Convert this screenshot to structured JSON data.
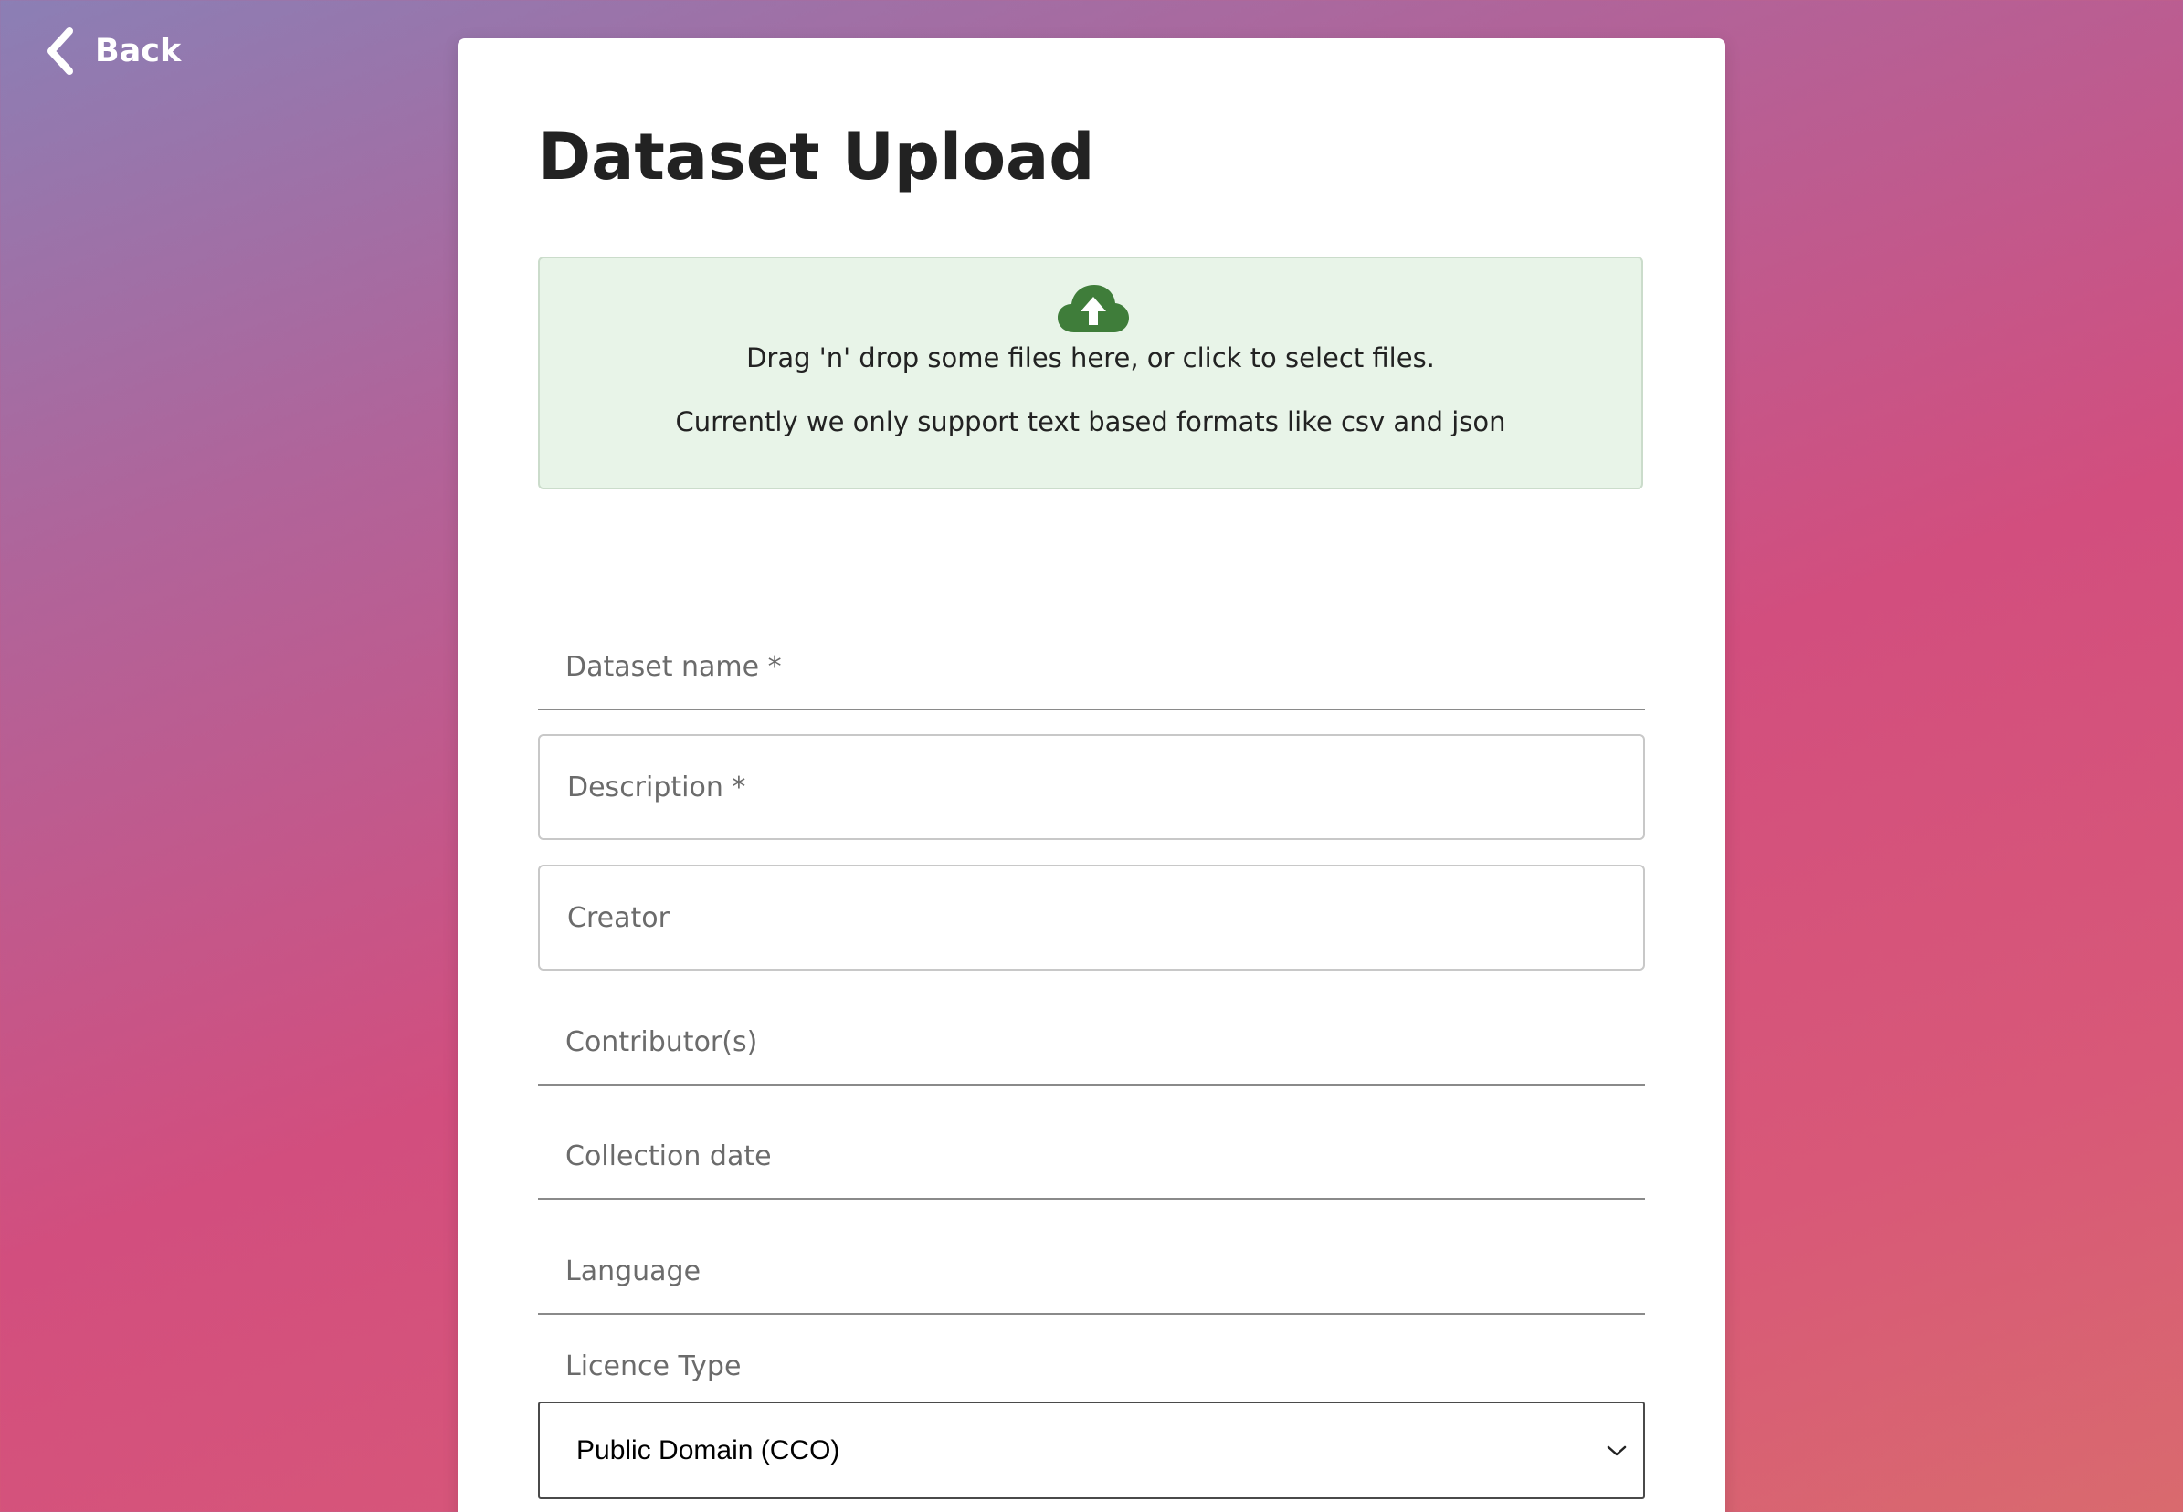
{
  "nav": {
    "back_label": "Back"
  },
  "page": {
    "title": "Dataset Upload"
  },
  "dropzone": {
    "icon": "cloud-upload-icon",
    "line1": "Drag 'n' drop some files here, or click to select files.",
    "line2": "Currently we only support text based formats like csv and json",
    "accent_color": "#3f7d3a"
  },
  "form": {
    "dataset_name": {
      "placeholder": "Dataset name *",
      "value": ""
    },
    "description": {
      "placeholder": "Description *",
      "value": ""
    },
    "creator": {
      "placeholder": "Creator",
      "value": ""
    },
    "contributors": {
      "placeholder": "Contributor(s)",
      "value": ""
    },
    "collection_date": {
      "placeholder": "Collection date",
      "value": ""
    },
    "language": {
      "placeholder": "Language",
      "value": ""
    },
    "licence": {
      "label": "Licence Type",
      "selected": "Public Domain (CCO)"
    }
  }
}
